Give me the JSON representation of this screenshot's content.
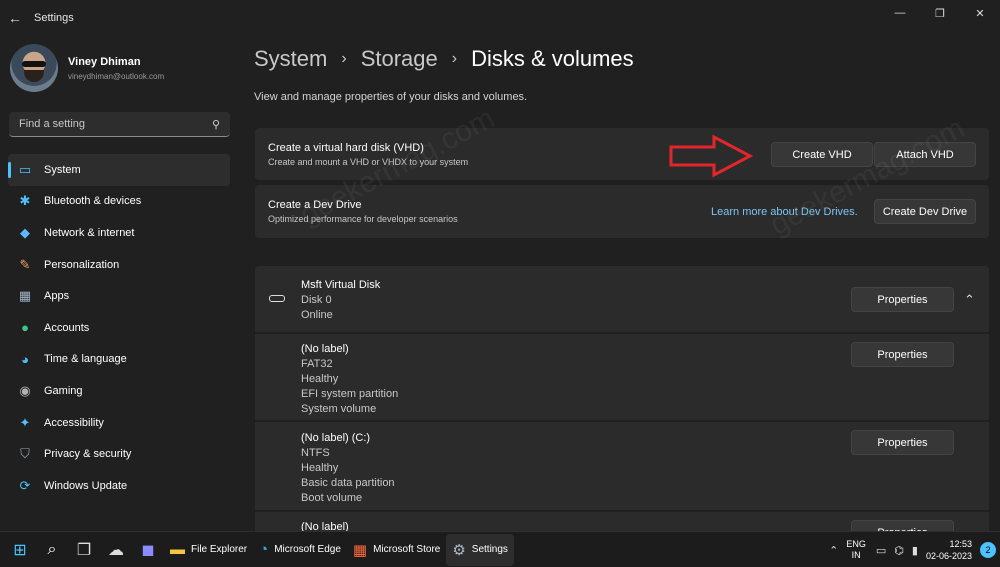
{
  "window": {
    "title": "Settings",
    "back_glyph": "←",
    "controls": [
      "—",
      "❐",
      "✕"
    ]
  },
  "profile": {
    "name": "Viney Dhiman",
    "email": "vineydhiman@outlook.com"
  },
  "search": {
    "placeholder": "Find a setting",
    "icon": "search-icon"
  },
  "sidebar": {
    "items": [
      {
        "label": "System",
        "icon": "monitor-icon",
        "glyph": "▭",
        "color": "#4cc2ff",
        "active": true
      },
      {
        "label": "Bluetooth & devices",
        "icon": "bluetooth-icon",
        "glyph": "✱",
        "color": "#4cc2ff"
      },
      {
        "label": "Network & internet",
        "icon": "wifi-icon",
        "glyph": "◆",
        "color": "#5fb7ff"
      },
      {
        "label": "Personalization",
        "icon": "brush-icon",
        "glyph": "✎",
        "color": "#f0a860"
      },
      {
        "label": "Apps",
        "icon": "apps-icon",
        "glyph": "▦",
        "color": "#a0b4c8"
      },
      {
        "label": "Accounts",
        "icon": "person-icon",
        "glyph": "●",
        "color": "#3cc68a"
      },
      {
        "label": "Time & language",
        "icon": "globe-clock-icon",
        "glyph": "◕",
        "color": "#4cc2ff"
      },
      {
        "label": "Gaming",
        "icon": "gamepad-icon",
        "glyph": "◉",
        "color": "#b0b0b0"
      },
      {
        "label": "Accessibility",
        "icon": "accessibility-icon",
        "glyph": "✦",
        "color": "#4cc2ff"
      },
      {
        "label": "Privacy & security",
        "icon": "shield-icon",
        "glyph": "⛉",
        "color": "#9aa6b2"
      },
      {
        "label": "Windows Update",
        "icon": "update-icon",
        "glyph": "⟳",
        "color": "#4cc2ff"
      }
    ]
  },
  "breadcrumb": {
    "items": [
      "System",
      "Storage",
      "Disks & volumes"
    ],
    "separator": "›"
  },
  "subtitle": "View and manage properties of your disks and volumes.",
  "vhd_card": {
    "title": "Create a virtual hard disk (VHD)",
    "description": "Create and mount a VHD or VHDX to your system",
    "create_button": "Create VHD",
    "attach_button": "Attach VHD"
  },
  "dev_drive_card": {
    "title": "Create a Dev Drive",
    "description": "Optimized performance for developer scenarios",
    "link": "Learn more about Dev Drives.",
    "button": "Create Dev Drive"
  },
  "disk": {
    "name": "Msft Virtual Disk",
    "number": "Disk 0",
    "status": "Online",
    "properties_button": "Properties",
    "collapse_glyph": "⌃"
  },
  "volumes": [
    {
      "lines": [
        "(No label)",
        "FAT32",
        "Healthy",
        "EFI system partition",
        "System volume"
      ],
      "button": "Properties"
    },
    {
      "lines": [
        "(No label) (C:)",
        "NTFS",
        "Healthy",
        "Basic data partition",
        "Boot volume"
      ],
      "button": "Properties"
    },
    {
      "lines": [
        "(No label)"
      ],
      "button": "Properties"
    }
  ],
  "watermark": "geekermag.com",
  "taskbar": {
    "pinned": [
      {
        "icon": "windows-start-icon",
        "glyph": "⊞",
        "color": "#4cc2ff"
      },
      {
        "icon": "search-icon",
        "glyph": "⌕",
        "color": "#ffffff"
      },
      {
        "icon": "task-view-icon",
        "glyph": "❐",
        "color": "#dddddd"
      },
      {
        "icon": "widgets-icon",
        "glyph": "☁",
        "color": "#dddddd"
      },
      {
        "icon": "teams-chat-icon",
        "glyph": "◼",
        "color": "#8b8cff"
      }
    ],
    "apps": [
      {
        "label": "File Explorer",
        "icon": "folder-icon",
        "glyph": "▬",
        "color": "#f5c542"
      },
      {
        "label": "Microsoft Edge",
        "icon": "edge-icon",
        "glyph": "◔",
        "color": "#2fb3e8"
      },
      {
        "label": "Microsoft Store",
        "icon": "store-icon",
        "glyph": "▦",
        "color": "#ff6a3d"
      },
      {
        "label": "Settings",
        "icon": "gear-icon",
        "glyph": "⚙",
        "color": "#a9b8c8",
        "active": true
      }
    ],
    "tray": {
      "chevron": "⌃",
      "lang_line1": "ENG",
      "lang_line2": "IN",
      "time": "12:53",
      "date": "02-06-2023",
      "notifications": "2"
    }
  }
}
